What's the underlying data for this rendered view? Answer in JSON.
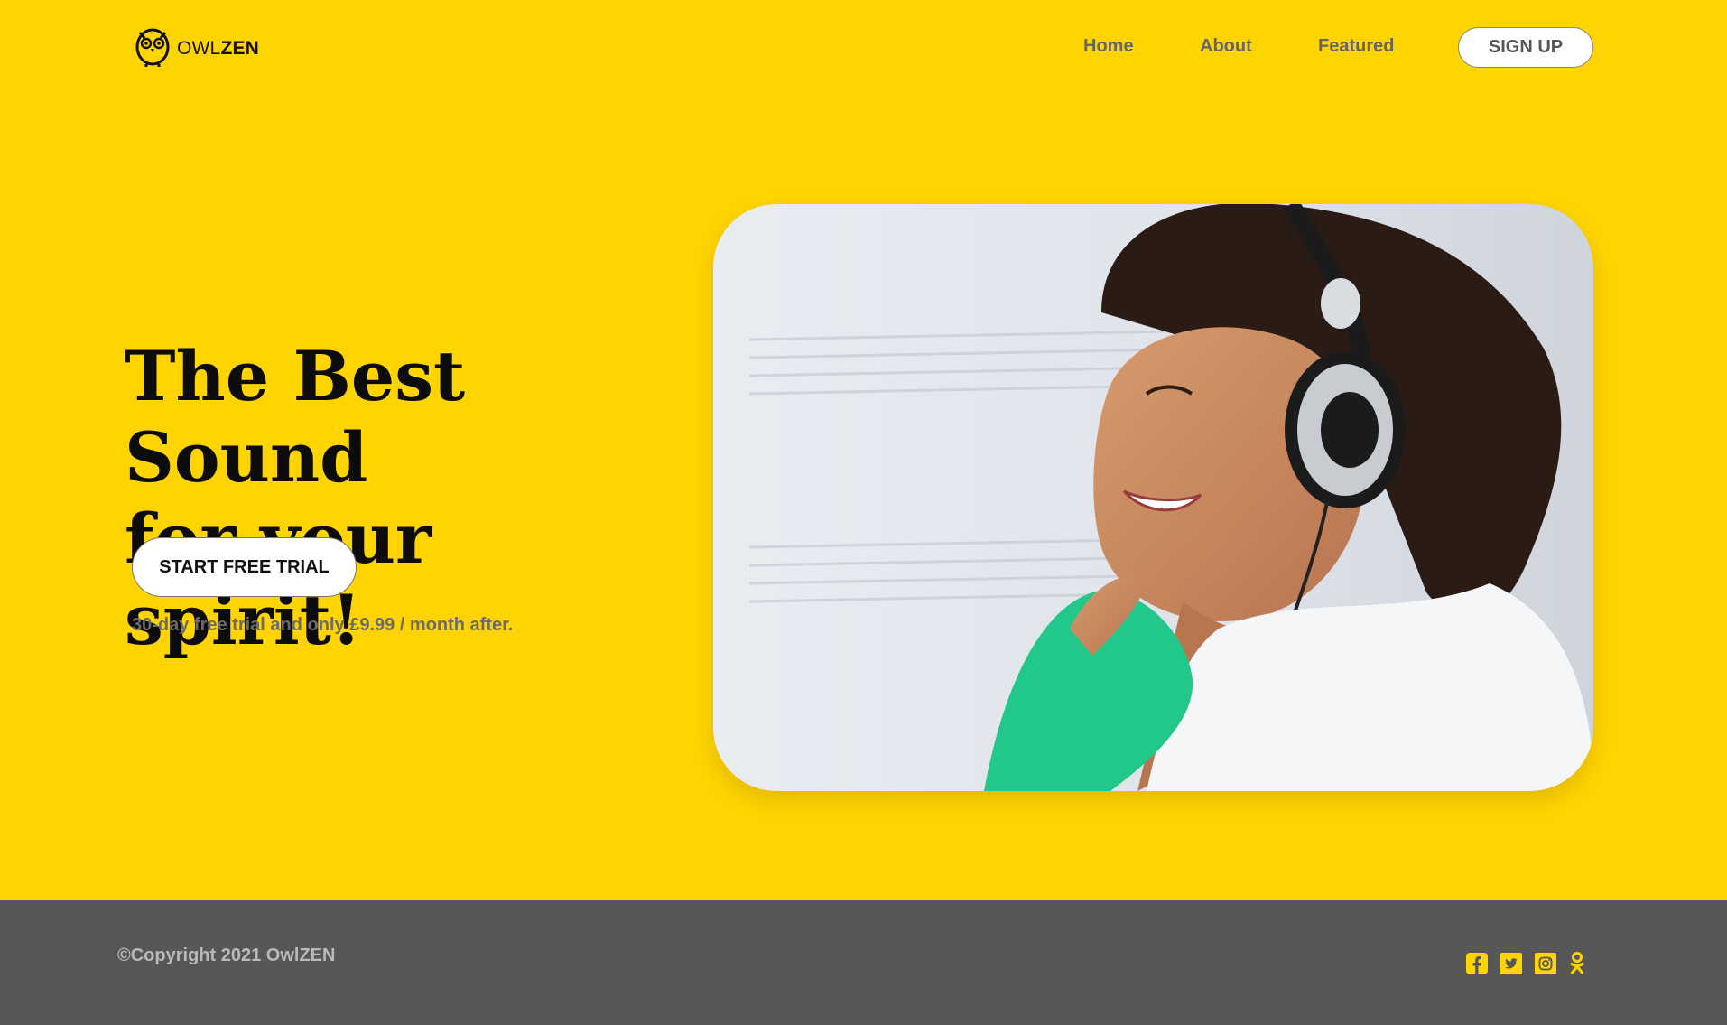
{
  "brand": {
    "logo_prefix": "OWL",
    "logo_suffix": "ZEN"
  },
  "nav": {
    "home": "Home",
    "about": "About",
    "featured": "Featured",
    "signup": "SIGN UP"
  },
  "hero": {
    "headline_line1": "The Best Sound",
    "headline_line2": "for your spirit!",
    "cta": "START FREE TRIAL",
    "note": "30-day free trial and only £9.99 / month after."
  },
  "footer": {
    "copyright": "©Copyright 2021 OwlZEN"
  },
  "socials": [
    "facebook-icon",
    "twitter-icon",
    "instagram-icon",
    "odnoklassniki-icon"
  ],
  "colors": {
    "background": "#FFD400",
    "footer": "#575757",
    "icon": "#FFD400"
  }
}
